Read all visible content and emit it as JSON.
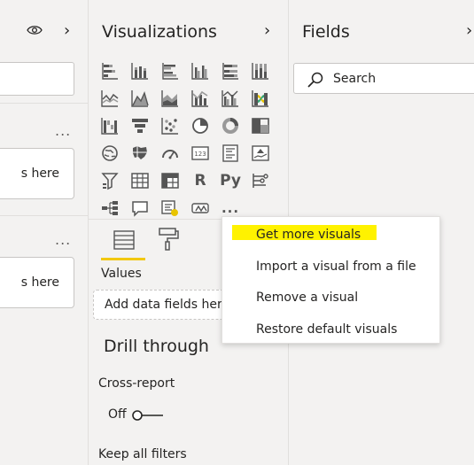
{
  "left_pane": {
    "well1_text": "s here",
    "well2_text": "s here",
    "more": "...",
    "more2": "..."
  },
  "visualizations": {
    "title": "Visualizations",
    "icons": [
      "stacked-bar-chart-icon",
      "stacked-column-chart-icon",
      "clustered-bar-chart-icon",
      "clustered-column-chart-icon",
      "100-stacked-bar-chart-icon",
      "100-stacked-column-chart-icon",
      "line-chart-icon",
      "area-chart-icon",
      "stacked-area-chart-icon",
      "line-and-stacked-column-chart-icon",
      "line-and-clustered-column-chart-icon",
      "ribbon-chart-icon",
      "waterfall-chart-icon",
      "funnel-chart-icon",
      "scatter-chart-icon",
      "pie-chart-icon",
      "donut-chart-icon",
      "treemap-icon",
      "map-icon",
      "filled-map-icon",
      "gauge-icon",
      "card-icon",
      "multi-row-card-icon",
      "kpi-icon",
      "slicer-icon",
      "table-icon",
      "matrix-icon",
      "r-script-visual-icon",
      "python-visual-icon",
      "key-influencers-icon",
      "decomposition-tree-icon",
      "qa-icon",
      "smart-narrative-icon",
      "paginated-report-icon",
      "more-visuals-icon"
    ],
    "r_label": "R",
    "py_label": "Py",
    "more_label": "...",
    "values_label": "Values",
    "add_field_placeholder": "Add data fields here",
    "drill_through_title": "Drill through",
    "cross_report_label": "Cross-report",
    "toggle_state": "Off",
    "keep_all_filters_label": "Keep all filters"
  },
  "fields": {
    "title": "Fields",
    "search_placeholder": "Search"
  },
  "context_menu": {
    "items": [
      "Get more visuals",
      "Import a visual from a file",
      "Remove a visual",
      "Restore default visuals"
    ],
    "highlight_color": "#fff200"
  },
  "colors": {
    "accent": "#f2c811",
    "pane_bg": "#f3f2f1"
  }
}
